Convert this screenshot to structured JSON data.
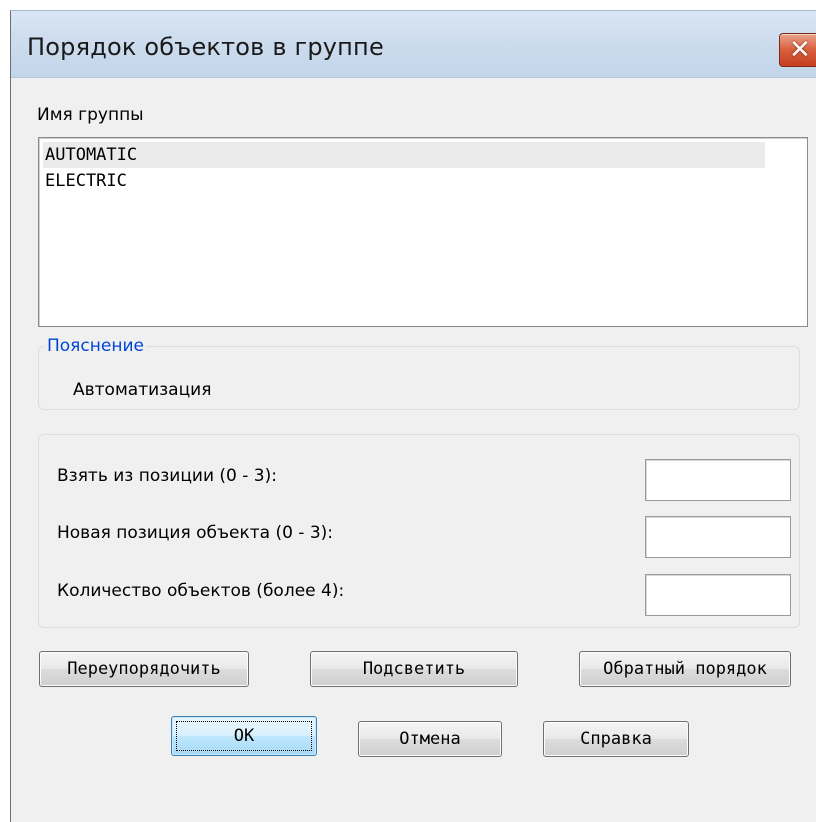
{
  "dialog": {
    "title": "Порядок объектов в группе",
    "close_icon": "close-icon"
  },
  "group_list": {
    "label": "Имя группы",
    "items": [
      "AUTOMATIC",
      "ELECTRIC"
    ],
    "selected_index": 0
  },
  "explanation": {
    "legend": "Пояснение",
    "text": "Автоматизация"
  },
  "positions": {
    "take_from_label": "Взять из позиции (0 - 3):",
    "take_from_value": "",
    "new_position_label": "Новая позиция объекта (0 - 3):",
    "new_position_value": "",
    "count_label": "Количество объектов (более 4):",
    "count_value": ""
  },
  "actions": {
    "reorder": "Переупорядочить",
    "highlight": "Подсветить",
    "reverse_order": "Обратный порядок"
  },
  "footer": {
    "ok": "OK",
    "cancel": "Отмена",
    "help": "Справка"
  },
  "colors": {
    "legend_blue": "#0046d5",
    "close_red": "#c53e1f",
    "titlebar": "#cddcee"
  }
}
